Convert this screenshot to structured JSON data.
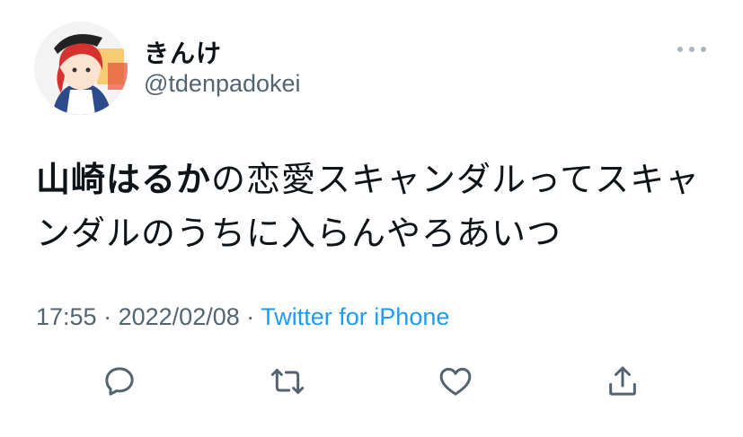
{
  "author": {
    "display_name": "きんけ",
    "handle": "@tdenpadokei"
  },
  "tweet": {
    "mention": "山崎はるか",
    "body": "の恋愛スキャンダルってスキャンダルのうちに入らんやろあいつ"
  },
  "meta": {
    "time": "17:55",
    "sep1": "·",
    "date": "2022/02/08",
    "sep2": "·",
    "source": "Twitter for iPhone"
  },
  "icons": {
    "reply": "reply-icon",
    "retweet": "retweet-icon",
    "like": "like-icon",
    "share": "share-icon",
    "more": "more-icon"
  },
  "colors": {
    "text": "#0f1419",
    "secondary": "#536471",
    "link": "#1d9bf0",
    "icon": "#536471"
  }
}
